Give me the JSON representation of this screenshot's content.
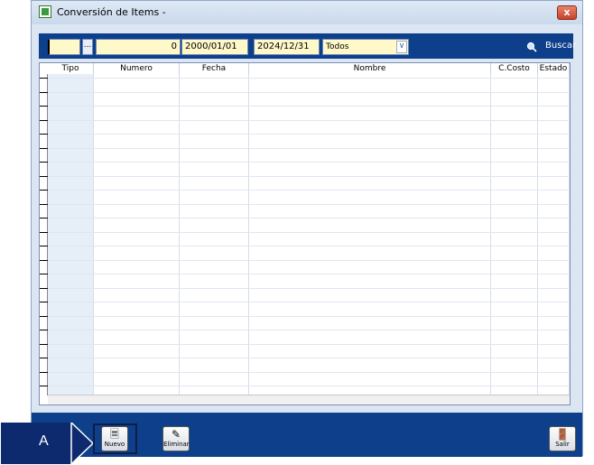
{
  "window": {
    "title": "Conversión de Items -",
    "close_label": "x"
  },
  "toolbar": {
    "code_value": "",
    "browse_label": "...",
    "number_value": "0",
    "date_from": "2000/01/01",
    "date_to": "2024/12/31",
    "status_filter": "Todos",
    "search_label": "Buscar"
  },
  "grid": {
    "columns": [
      "Tipo",
      "Numero",
      "Fecha",
      "Nombre",
      "C.Costo",
      "Estado"
    ],
    "rows": 23
  },
  "actions": {
    "new_label": "Nuevo",
    "delete_label": "Eliminar",
    "exit_label": "Salir"
  },
  "annotation": {
    "label": "A"
  },
  "colors": {
    "toolbar_bg": "#0e3f8a",
    "field_bg": "#fff8c8",
    "window_bg": "#dce6f2"
  }
}
